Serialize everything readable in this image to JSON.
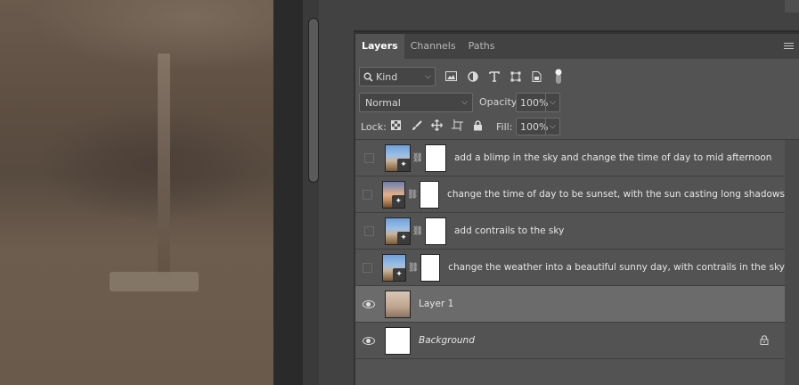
{
  "panel": {
    "tabs": [
      {
        "label": "Layers",
        "active": true
      },
      {
        "label": "Channels",
        "active": false
      },
      {
        "label": "Paths",
        "active": false
      }
    ],
    "filter": {
      "kind_label": "Kind"
    },
    "blend_mode": "Normal",
    "opacity_label": "Opacity:",
    "opacity_value": "100%",
    "lock_label": "Lock:",
    "fill_label": "Fill:",
    "fill_value": "100%"
  },
  "layers": [
    {
      "name": "add a blimp in the sky and change the time of day to mid afternoon",
      "visible": false,
      "type": "generative"
    },
    {
      "name": "change the time of day to be sunset, with the sun casting long shadows",
      "visible": false,
      "type": "generative"
    },
    {
      "name": "add contrails to the sky",
      "visible": false,
      "type": "generative"
    },
    {
      "name": "change the weather into a beautiful sunny day, with contrails in the sky",
      "visible": false,
      "type": "generative"
    },
    {
      "name": "Layer 1",
      "visible": true,
      "selected": true,
      "type": "pixel"
    },
    {
      "name": "Background",
      "visible": true,
      "locked": true,
      "type": "background"
    }
  ],
  "colors": {
    "panel_bg": "#535353",
    "selected_row": "#6b6b6b",
    "tab_bar": "#424242"
  }
}
